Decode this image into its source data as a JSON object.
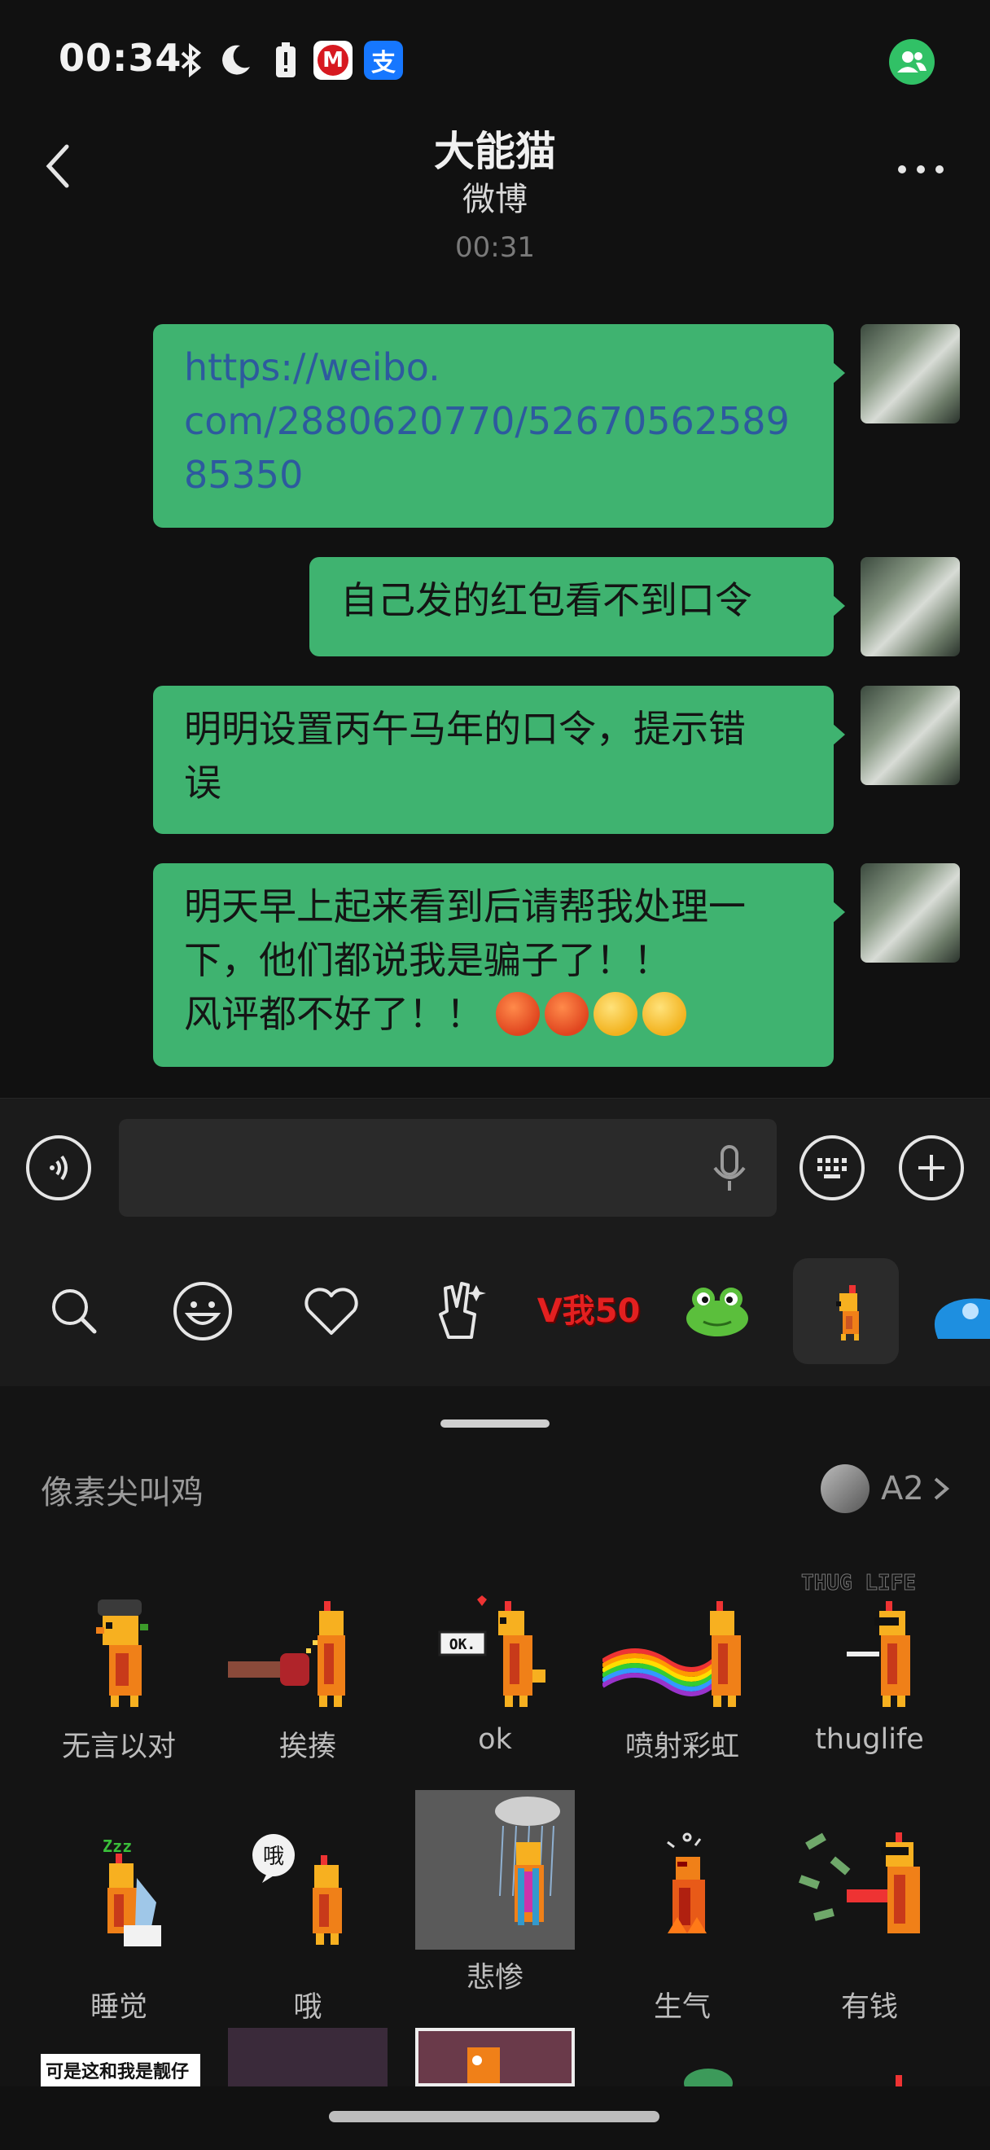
{
  "status_bar": {
    "time": "00:34",
    "icons": [
      "bluetooth-icon",
      "moon-icon",
      "battery-alert-icon",
      "cmb-app-icon",
      "alipay-app-icon"
    ],
    "right_icon": "contacts-icon",
    "alipay_glyph": "支",
    "cmb_glyph": "M"
  },
  "header": {
    "title": "大能猫",
    "subtitle": "微博",
    "time": "00:31"
  },
  "messages": [
    {
      "text": "https://weibo.com/2880620770/5267056258985350",
      "lines": [
        "https://weibo.",
        "com/2880620770/52670562589",
        "85350"
      ],
      "is_link": true
    },
    {
      "text": "自己发的红包看不到口令"
    },
    {
      "text_lines": [
        "明明设置丙午马年的口令，提示错",
        "误"
      ]
    },
    {
      "text_lines": [
        "明天早上起来看到后请帮我处理一",
        "下，他们都说我是骗子了！！",
        "风评都不好了！！"
      ],
      "emojis": [
        "angry-face",
        "angry-face",
        "winking-face",
        "winking-face"
      ]
    }
  ],
  "input_bar": {
    "voice_icon": "voice-icon",
    "mic_icon": "microphone-icon",
    "keyboard_icon": "keyboard-icon",
    "add_icon": "plus-icon",
    "value": ""
  },
  "emoji_tabs": [
    {
      "name": "search-icon"
    },
    {
      "name": "smiley-icon"
    },
    {
      "name": "heart-icon"
    },
    {
      "name": "peace-hand-icon"
    },
    {
      "name": "v50-sticker-pack",
      "label": "V我50"
    },
    {
      "name": "frog-sticker-pack"
    },
    {
      "name": "chicken-sticker-pack",
      "selected": true
    },
    {
      "name": "blue-sticker-pack"
    }
  ],
  "panel": {
    "pack_title": "像素尖叫鸡",
    "author": "A2",
    "stickers": [
      {
        "label": "无言以对"
      },
      {
        "label": "挨揍"
      },
      {
        "label": "ok",
        "badge": "OK."
      },
      {
        "label": "喷射彩虹"
      },
      {
        "label": "thuglife",
        "badge": "THUG LIFE"
      },
      {
        "label": "睡觉",
        "badge": "Zzz"
      },
      {
        "label": "哦",
        "badge": "哦"
      },
      {
        "label": "悲惨"
      },
      {
        "label": "生气"
      },
      {
        "label": "有钱"
      }
    ],
    "partial_row_text": "可是这和我是靓仔"
  }
}
